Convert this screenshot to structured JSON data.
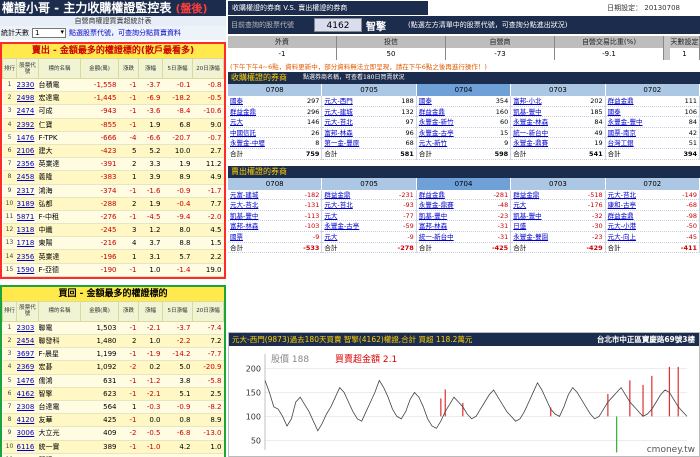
{
  "title": {
    "main": "權證小哥 - 主力收購權證監控表",
    "tag": "(盤後)"
  },
  "left": {
    "subtitle": "自營商權證買賣超統計表",
    "days_label": "統計天數",
    "days_value": "1",
    "days_hint": "點選股票代號，可查詢分點買賣資料",
    "sell": {
      "title": "賣出 - 金額最多的權證標的(散戶最看多)",
      "headers": [
        "排行",
        "股票代號",
        "標的名稱",
        "金額(萬)",
        "漲跌",
        "漲幅",
        "5日漲幅",
        "20日漲幅"
      ],
      "rows": [
        [
          "1",
          "2330",
          "台積電",
          "-1,558",
          "-1",
          "-3.7",
          "-0.1",
          "-0.8"
        ],
        [
          "2",
          "2498",
          "宏達電",
          "-1,445",
          "-1",
          "-6.9",
          "-18.2",
          "-0.5"
        ],
        [
          "3",
          "2474",
          "可成",
          "-943",
          "-1",
          "-3.6",
          "-8.4",
          "-10.6"
        ],
        [
          "4",
          "2392",
          "仁寶",
          "-855",
          "-1",
          "1.9",
          "6.8",
          "9.0"
        ],
        [
          "5",
          "1476",
          "F-TPK",
          "-666",
          "-4",
          "-6.6",
          "-20.7",
          "-0.7"
        ],
        [
          "6",
          "2106",
          "建大",
          "-423",
          "5",
          "5.2",
          "10.0",
          "2.7"
        ],
        [
          "7",
          "2356",
          "英業達",
          "-391",
          "2",
          "3.3",
          "1.9",
          "11.2"
        ],
        [
          "8",
          "2458",
          "義隆",
          "-383",
          "1",
          "3.9",
          "8.9",
          "4.9"
        ],
        [
          "9",
          "2317",
          "鴻海",
          "-374",
          "-1",
          "-1.6",
          "-0.9",
          "-1.7"
        ],
        [
          "10",
          "3189",
          "弘都",
          "-288",
          "2",
          "1.9",
          "-0.4",
          "7.7"
        ],
        [
          "11",
          "5871",
          "F-中租",
          "-276",
          "-1",
          "-4.5",
          "-9.4",
          "-2.0"
        ],
        [
          "12",
          "1318",
          "中纖",
          "-245",
          "3",
          "1.2",
          "8.0",
          "4.5"
        ],
        [
          "13",
          "1718",
          "東陽",
          "-216",
          "4",
          "3.7",
          "8.8",
          "1.5"
        ],
        [
          "14",
          "2356",
          "英業達",
          "-196",
          "1",
          "3.1",
          "5.7",
          "2.2"
        ],
        [
          "15",
          "1590",
          "F-亞德",
          "-190",
          "-1",
          "1.0",
          "-1.4",
          "19.0"
        ]
      ]
    },
    "buy": {
      "title": "買回 - 金額最多的權證標的",
      "headers": [
        "排行",
        "股票代號",
        "標的名稱",
        "金額(萬)",
        "漲跌",
        "漲幅",
        "5日漲幅",
        "20日漲幅"
      ],
      "rows": [
        [
          "1",
          "2303",
          "聯電",
          "1,503",
          "-1",
          "-2.1",
          "-3.7",
          "-7.4"
        ],
        [
          "2",
          "2454",
          "聯發科",
          "1,480",
          "2",
          "1.0",
          "-2.2",
          "7.2"
        ],
        [
          "3",
          "3697",
          "F-晨星",
          "1,199",
          "-1",
          "-1.9",
          "-14.2",
          "-7.7"
        ],
        [
          "4",
          "2369",
          "宏碁",
          "1,092",
          "-2",
          "0.2",
          "5.0",
          "-20.9"
        ],
        [
          "5",
          "1476",
          "儒鴻",
          "631",
          "-1",
          "-1.2",
          "3.8",
          "-5.8"
        ],
        [
          "6",
          "4162",
          "智擎",
          "623",
          "-1",
          "-2.1",
          "5.1",
          "2.5"
        ],
        [
          "7",
          "2308",
          "台達電",
          "564",
          "1",
          "-0.3",
          "-0.9",
          "-8.2"
        ],
        [
          "8",
          "4120",
          "友華",
          "425",
          "-1",
          "0.0",
          "0.8",
          "8.9"
        ],
        [
          "9",
          "3006",
          "大立光",
          "409",
          "-2",
          "-0.5",
          "-6.8",
          "-13.0"
        ],
        [
          "10",
          "6116",
          "統一實",
          "389",
          "-1",
          "-1.0",
          "4.2",
          "1.0"
        ],
        [
          "11",
          "8255",
          "朋程",
          "236",
          "-1",
          "-1.2",
          "-4.2",
          "-5.4"
        ]
      ]
    }
  },
  "right": {
    "header": "收購權證的券商 V.S. 賣出權證的券商",
    "date_label": "日期設定",
    "date_value": "20130708",
    "query_label": "目前查詢的股票代號",
    "query_code": "4162",
    "query_name": "智擎",
    "query_hint": "(點選左方清單中的股票代號，可查詢分點進出狀況)",
    "stats_headers": [
      "外資",
      "投信",
      "自營商",
      "自營交易比重(%)",
      "天數設定"
    ],
    "stats_values": [
      "-1",
      "50",
      "-73",
      "-9.1",
      "1"
    ],
    "notice": "(下午下午4~6點，資料更新中，部分資料無法立即呈現，請在下午6點之後再進行操作！)",
    "buy_section": {
      "title": "收購權證的券商",
      "mid": "點選券商名稱，可查看180日買賣狀況",
      "dates": [
        "0708",
        "0705",
        "0704",
        "0703",
        "0702"
      ],
      "cols": [
        [
          [
            "國泰",
            "297"
          ],
          [
            "群益金鼎",
            "296"
          ],
          [
            "元大",
            "146"
          ],
          [
            "中國信託",
            "26"
          ],
          [
            "永豐金-中壢",
            "8"
          ],
          [
            "合計",
            "759"
          ]
        ],
        [
          [
            "元大-西門",
            "188"
          ],
          [
            "元大-建城",
            "132"
          ],
          [
            "元大-苔北",
            "97"
          ],
          [
            "富邦-林森",
            "96"
          ],
          [
            "第一金-豐原",
            "68"
          ],
          [
            "合計",
            "581"
          ]
        ],
        [
          [
            "國泰",
            "354"
          ],
          [
            "群益金鼎",
            "160"
          ],
          [
            "永豐金-新竹",
            "60"
          ],
          [
            "永豐金-古亭",
            "15"
          ],
          [
            "元大-新竹",
            "9"
          ],
          [
            "合計",
            "598"
          ]
        ],
        [
          [
            "富邦-小北",
            "202"
          ],
          [
            "凱基-豐中",
            "185"
          ],
          [
            "永豐金-林森",
            "84"
          ],
          [
            "統一-新台中",
            "49"
          ],
          [
            "永豐金-鼎賽",
            "19"
          ],
          [
            "合計",
            "541"
          ]
        ],
        [
          [
            "群益金鼎",
            "111"
          ],
          [
            "國泰",
            "106"
          ],
          [
            "永豐金-豐中",
            "84"
          ],
          [
            "國票-南京",
            "42"
          ],
          [
            "台灣工銀",
            "51"
          ],
          [
            "合計",
            "394"
          ]
        ]
      ]
    },
    "sell_section": {
      "title": "賣出權證的券商",
      "dates": [
        "0708",
        "0705",
        "0704",
        "0703",
        "0702"
      ],
      "cols": [
        [
          [
            "元富-建城",
            "-182"
          ],
          [
            "元大-苔北",
            "-131"
          ],
          [
            "凱基-豐中",
            "-113"
          ],
          [
            "富邦-林森",
            "-103"
          ],
          [
            "國票",
            "-9"
          ],
          [
            "合計",
            "-533"
          ]
        ],
        [
          [
            "群益金鼎",
            "-231"
          ],
          [
            "元大-苔北",
            "-93"
          ],
          [
            "元大",
            "-77"
          ],
          [
            "永豐金-古亭",
            "-59"
          ],
          [
            "元大",
            "-9"
          ],
          [
            "合計",
            "-278"
          ]
        ],
        [
          [
            "群益金鼎",
            "-281"
          ],
          [
            "永豐金-鼎賽",
            "-48"
          ],
          [
            "凱基-豐中",
            "-23"
          ],
          [
            "富邦-林森",
            "-31"
          ],
          [
            "統一-新台中",
            "-31"
          ],
          [
            "合計",
            "-425"
          ]
        ],
        [
          [
            "群益金鼎",
            "-518"
          ],
          [
            "元大",
            "-176"
          ],
          [
            "凱基-豐中",
            "-32"
          ],
          [
            "日盛",
            "-30"
          ],
          [
            "永豐金-雙園",
            "-23"
          ],
          [
            "合計",
            "-429"
          ]
        ],
        [
          [
            "元大-苔北",
            "-149"
          ],
          [
            "康和-古亭",
            "-68"
          ],
          [
            "群益金鼎",
            "-98"
          ],
          [
            "元大-小港",
            "-50"
          ],
          [
            "元大-向上",
            "-45"
          ],
          [
            "合計",
            "-411"
          ]
        ]
      ]
    },
    "chart": {
      "title": "元大-西門(9873)過去180天買賣 智擎(4162)權證,合計 買超 118.2萬元",
      "address": "台北市中正區寶慶路69號3樓",
      "legend_price": "股價 188",
      "legend_amt": "買賣超金額 2.1",
      "y_ticks": [
        "200",
        "150",
        "100",
        "50"
      ],
      "watermark": "cmoney.tw"
    }
  },
  "colors": {
    "navy": "#1c2c4c",
    "red": "#ff2b2b",
    "green": "#19a53a",
    "yellow": "#ffe94d"
  },
  "chart_data": {
    "type": "line",
    "ylim": [
      30,
      230
    ],
    "price": [
      175,
      150,
      120,
      115,
      100,
      80,
      95,
      130,
      140,
      125,
      110,
      90,
      70,
      85,
      105,
      120,
      140,
      160,
      150,
      130,
      110,
      95,
      90,
      110,
      130,
      150,
      175,
      160,
      140,
      115,
      100,
      95,
      110,
      135,
      150,
      140,
      120,
      95,
      80,
      75,
      90,
      110,
      125,
      140,
      130,
      120,
      105,
      95,
      100,
      115,
      130,
      145,
      155,
      140,
      125,
      110,
      100,
      90,
      95,
      110,
      130,
      150,
      170,
      155,
      135,
      115,
      105,
      100,
      120,
      145,
      160,
      150,
      135,
      120,
      105,
      95,
      100,
      115,
      130,
      140,
      150,
      160,
      145,
      130,
      120,
      110,
      100,
      105,
      115,
      130,
      145,
      155,
      150,
      135,
      120,
      110,
      100
    ],
    "bars_red": [
      [
        40,
        20
      ],
      [
        41,
        30
      ],
      [
        45,
        15
      ],
      [
        65,
        10
      ],
      [
        78,
        25
      ],
      [
        83,
        40
      ],
      [
        86,
        35
      ],
      [
        88,
        45
      ],
      [
        92,
        55
      ],
      [
        94,
        55
      ]
    ],
    "bars_green": [
      [
        80,
        -40
      ]
    ]
  }
}
